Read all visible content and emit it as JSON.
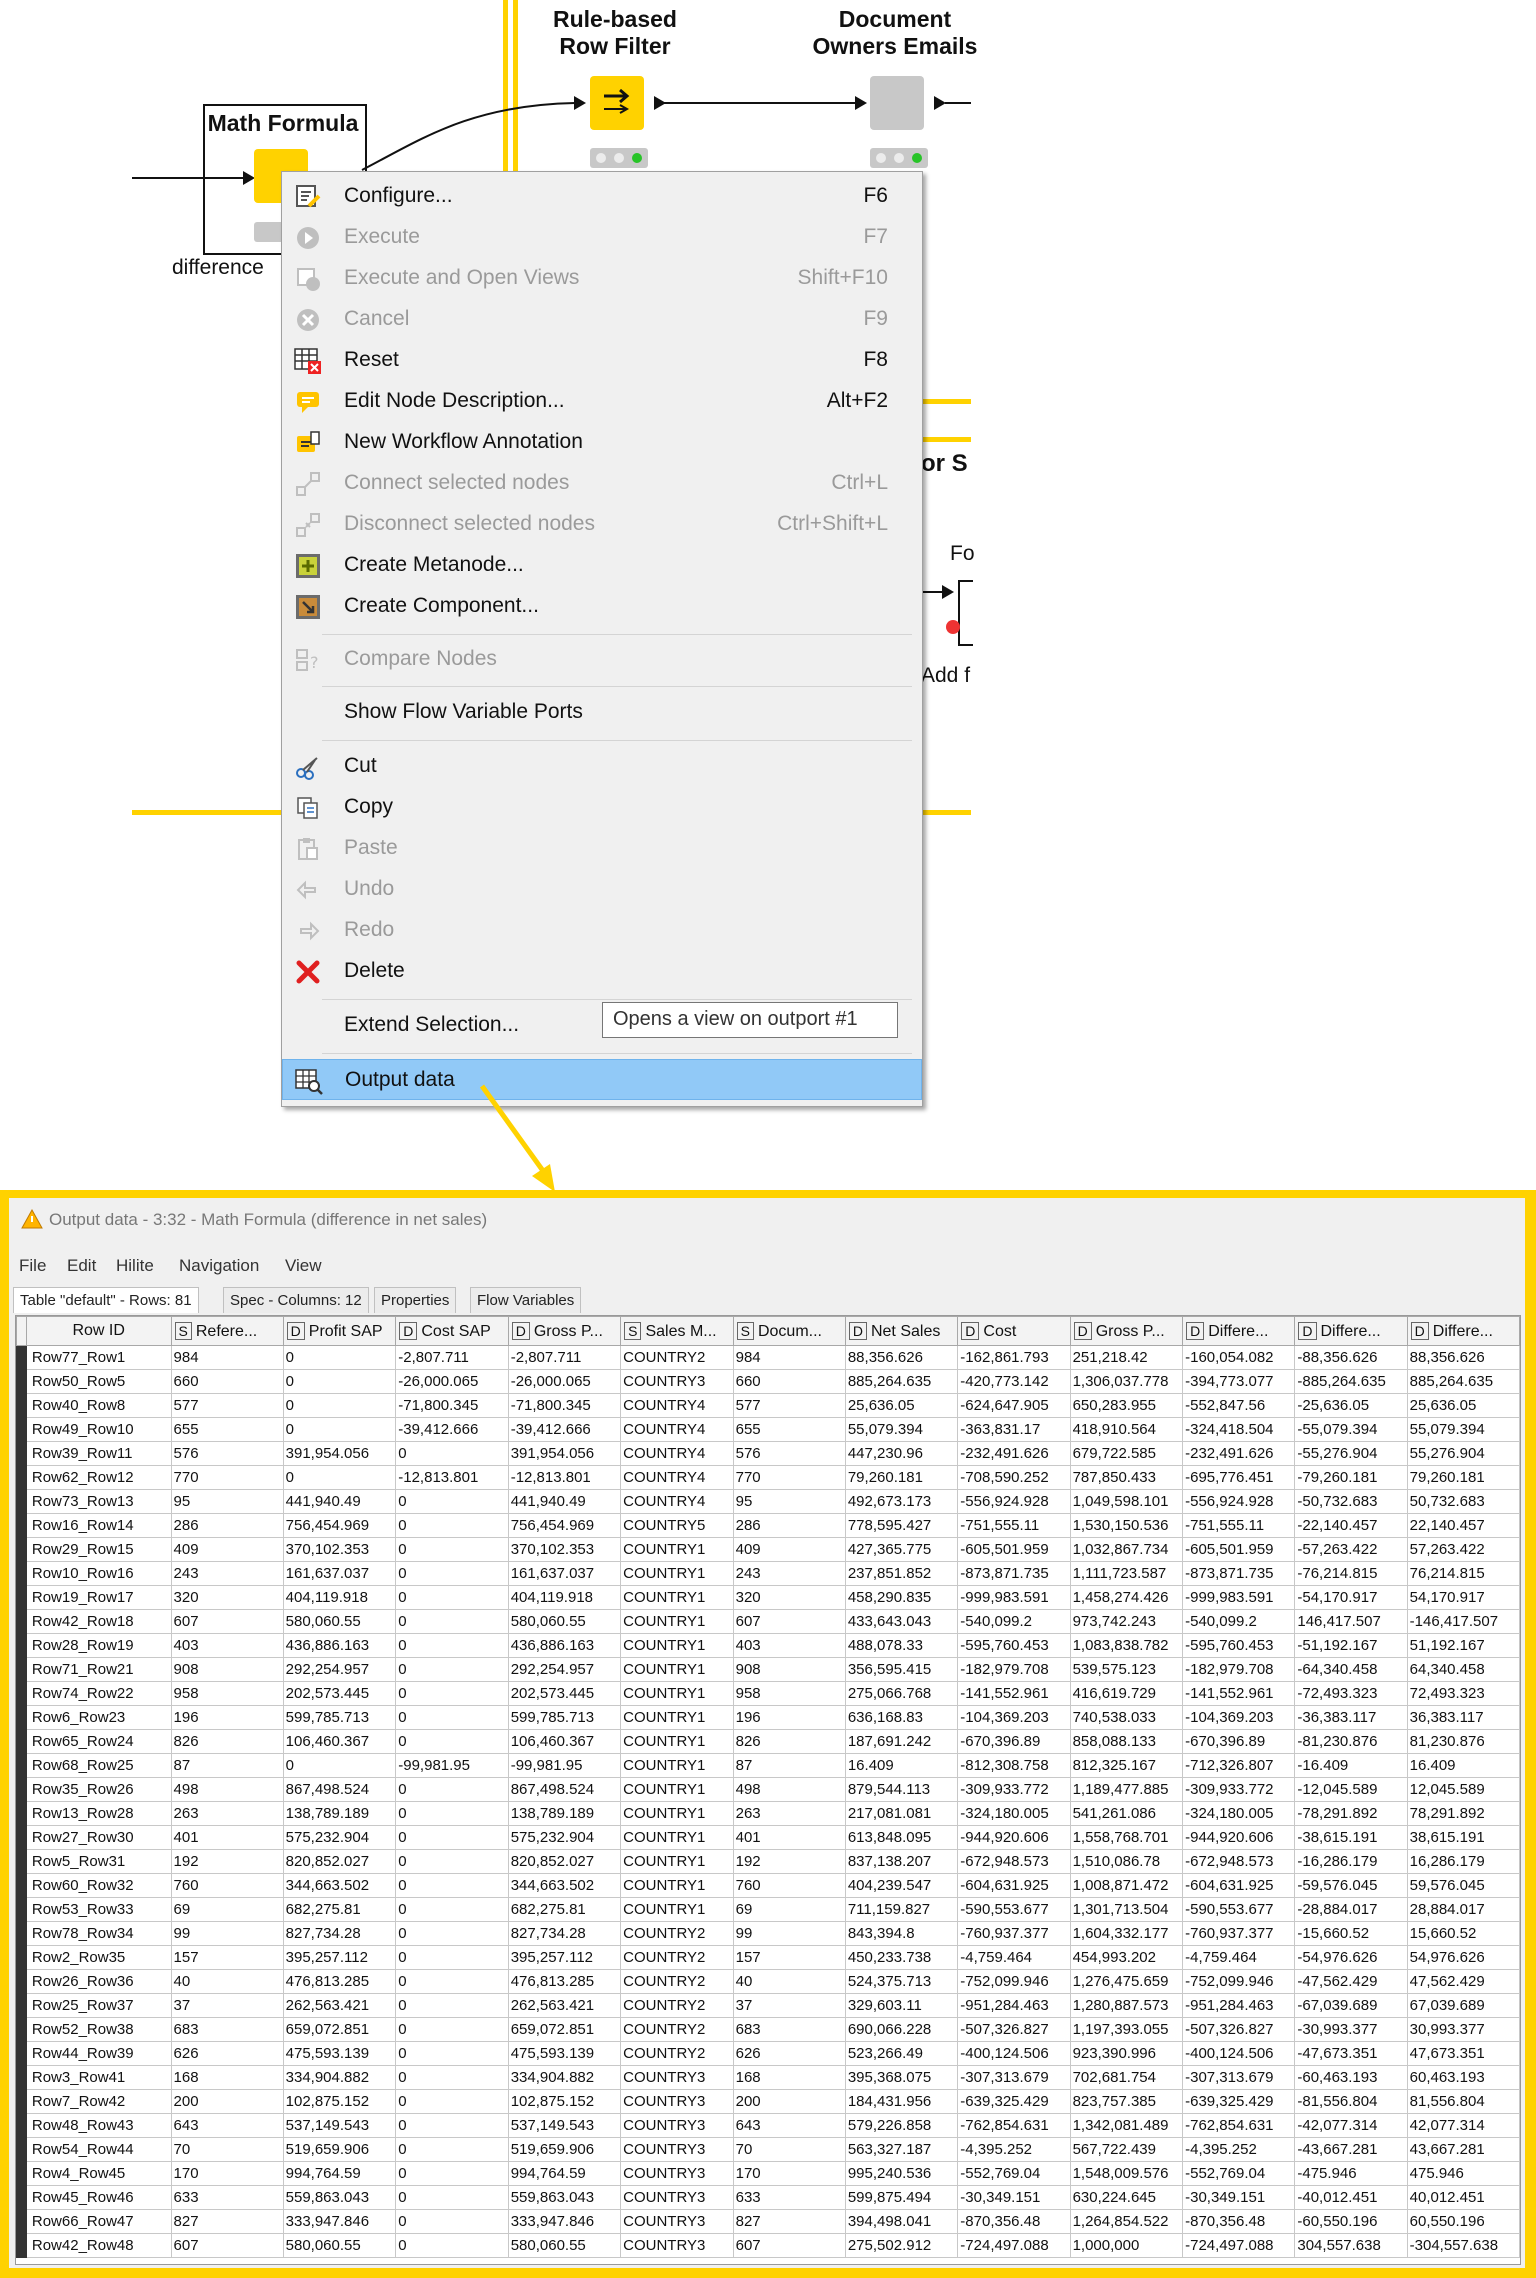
{
  "workflow": {
    "nodes": {
      "math_formula": {
        "title": "Math Formula",
        "label": "difference"
      },
      "rule_filter": {
        "title_line1": "Rule-based",
        "title_line2": "Row Filter"
      },
      "doc_owners": {
        "title_line1": "Document",
        "title_line2": "Owners Emails"
      }
    },
    "partial_texts": {
      "or_s": "or S",
      "fo": "Fo",
      "add_f": "Add f"
    },
    "colors": {
      "annotation_border": "#ffd200",
      "node_yellow": "#ffd200",
      "node_gray": "#c8c8c8"
    }
  },
  "context_menu": {
    "items": [
      {
        "label": "Configure...",
        "shortcut": "F6",
        "icon": "configure-icon",
        "enabled": true
      },
      {
        "label": "Execute",
        "shortcut": "F7",
        "icon": "execute-icon",
        "enabled": false
      },
      {
        "label": "Execute and Open Views",
        "shortcut": "Shift+F10",
        "icon": "execute-open-views-icon",
        "enabled": false
      },
      {
        "label": "Cancel",
        "shortcut": "F9",
        "icon": "cancel-icon",
        "enabled": false
      },
      {
        "label": "Reset",
        "shortcut": "F8",
        "icon": "reset-icon",
        "enabled": true
      },
      {
        "label": "Edit Node Description...",
        "shortcut": "Alt+F2",
        "icon": "edit-description-icon",
        "enabled": true
      },
      {
        "label": "New Workflow Annotation",
        "shortcut": "",
        "icon": "annotation-icon",
        "enabled": true
      },
      {
        "label": "Connect selected nodes",
        "shortcut": "Ctrl+L",
        "icon": "connect-icon",
        "enabled": false
      },
      {
        "label": "Disconnect selected nodes",
        "shortcut": "Ctrl+Shift+L",
        "icon": "disconnect-icon",
        "enabled": false
      },
      {
        "label": "Create Metanode...",
        "shortcut": "",
        "icon": "metanode-icon",
        "enabled": true
      },
      {
        "label": "Create Component...",
        "shortcut": "",
        "icon": "component-icon",
        "enabled": true
      },
      {
        "label": "Compare Nodes",
        "shortcut": "",
        "icon": "compare-icon",
        "enabled": false
      },
      {
        "label": "Show Flow Variable Ports",
        "shortcut": "",
        "icon": "",
        "enabled": true
      },
      {
        "label": "Cut",
        "shortcut": "",
        "icon": "cut-icon",
        "enabled": true
      },
      {
        "label": "Copy",
        "shortcut": "",
        "icon": "copy-icon",
        "enabled": true
      },
      {
        "label": "Paste",
        "shortcut": "",
        "icon": "paste-icon",
        "enabled": false
      },
      {
        "label": "Undo",
        "shortcut": "",
        "icon": "undo-icon",
        "enabled": false
      },
      {
        "label": "Redo",
        "shortcut": "",
        "icon": "redo-icon",
        "enabled": false
      },
      {
        "label": "Delete",
        "shortcut": "",
        "icon": "delete-icon",
        "enabled": true
      },
      {
        "label": "Extend Selection...",
        "shortcut": "",
        "icon": "",
        "enabled": true
      },
      {
        "label": "Output data",
        "shortcut": "",
        "icon": "output-data-icon",
        "enabled": true,
        "selected": true
      }
    ],
    "tooltip": "Opens a view on outport #1"
  },
  "output_window": {
    "title": "Output data - 3:32 - Math Formula (difference in net sales)",
    "menu": [
      "File",
      "Edit",
      "Hilite",
      "Navigation",
      "View"
    ],
    "tabs": [
      "Table \"default\" - Rows: 81",
      "Spec - Columns: 12",
      "Properties",
      "Flow Variables"
    ],
    "columns": [
      {
        "type": "",
        "name": "Row ID"
      },
      {
        "type": "S",
        "name": "Refere..."
      },
      {
        "type": "D",
        "name": "Profit SAP"
      },
      {
        "type": "D",
        "name": "Cost SAP"
      },
      {
        "type": "D",
        "name": "Gross P..."
      },
      {
        "type": "S",
        "name": "Sales M..."
      },
      {
        "type": "S",
        "name": "Docum..."
      },
      {
        "type": "D",
        "name": "Net Sales"
      },
      {
        "type": "D",
        "name": "Cost"
      },
      {
        "type": "D",
        "name": "Gross P..."
      },
      {
        "type": "D",
        "name": "Differe..."
      },
      {
        "type": "D",
        "name": "Differe..."
      },
      {
        "type": "D",
        "name": "Differe..."
      }
    ],
    "rows": [
      [
        "Row77_Row1",
        "984",
        "0",
        "-2,807.711",
        "-2,807.711",
        "COUNTRY2",
        "984",
        "88,356.626",
        "-162,861.793",
        "251,218.42",
        "-160,054.082",
        "-88,356.626",
        "88,356.626"
      ],
      [
        "Row50_Row5",
        "660",
        "0",
        "-26,000.065",
        "-26,000.065",
        "COUNTRY3",
        "660",
        "885,264.635",
        "-420,773.142",
        "1,306,037.778",
        "-394,773.077",
        "-885,264.635",
        "885,264.635"
      ],
      [
        "Row40_Row8",
        "577",
        "0",
        "-71,800.345",
        "-71,800.345",
        "COUNTRY4",
        "577",
        "25,636.05",
        "-624,647.905",
        "650,283.955",
        "-552,847.56",
        "-25,636.05",
        "25,636.05"
      ],
      [
        "Row49_Row10",
        "655",
        "0",
        "-39,412.666",
        "-39,412.666",
        "COUNTRY4",
        "655",
        "55,079.394",
        "-363,831.17",
        "418,910.564",
        "-324,418.504",
        "-55,079.394",
        "55,079.394"
      ],
      [
        "Row39_Row11",
        "576",
        "391,954.056",
        "0",
        "391,954.056",
        "COUNTRY4",
        "576",
        "447,230.96",
        "-232,491.626",
        "679,722.585",
        "-232,491.626",
        "-55,276.904",
        "55,276.904"
      ],
      [
        "Row62_Row12",
        "770",
        "0",
        "-12,813.801",
        "-12,813.801",
        "COUNTRY4",
        "770",
        "79,260.181",
        "-708,590.252",
        "787,850.433",
        "-695,776.451",
        "-79,260.181",
        "79,260.181"
      ],
      [
        "Row73_Row13",
        "95",
        "441,940.49",
        "0",
        "441,940.49",
        "COUNTRY4",
        "95",
        "492,673.173",
        "-556,924.928",
        "1,049,598.101",
        "-556,924.928",
        "-50,732.683",
        "50,732.683"
      ],
      [
        "Row16_Row14",
        "286",
        "756,454.969",
        "0",
        "756,454.969",
        "COUNTRY5",
        "286",
        "778,595.427",
        "-751,555.11",
        "1,530,150.536",
        "-751,555.11",
        "-22,140.457",
        "22,140.457"
      ],
      [
        "Row29_Row15",
        "409",
        "370,102.353",
        "0",
        "370,102.353",
        "COUNTRY1",
        "409",
        "427,365.775",
        "-605,501.959",
        "1,032,867.734",
        "-605,501.959",
        "-57,263.422",
        "57,263.422"
      ],
      [
        "Row10_Row16",
        "243",
        "161,637.037",
        "0",
        "161,637.037",
        "COUNTRY1",
        "243",
        "237,851.852",
        "-873,871.735",
        "1,111,723.587",
        "-873,871.735",
        "-76,214.815",
        "76,214.815"
      ],
      [
        "Row19_Row17",
        "320",
        "404,119.918",
        "0",
        "404,119.918",
        "COUNTRY1",
        "320",
        "458,290.835",
        "-999,983.591",
        "1,458,274.426",
        "-999,983.591",
        "-54,170.917",
        "54,170.917"
      ],
      [
        "Row42_Row18",
        "607",
        "580,060.55",
        "0",
        "580,060.55",
        "COUNTRY1",
        "607",
        "433,643.043",
        "-540,099.2",
        "973,742.243",
        "-540,099.2",
        "146,417.507",
        "-146,417.507"
      ],
      [
        "Row28_Row19",
        "403",
        "436,886.163",
        "0",
        "436,886.163",
        "COUNTRY1",
        "403",
        "488,078.33",
        "-595,760.453",
        "1,083,838.782",
        "-595,760.453",
        "-51,192.167",
        "51,192.167"
      ],
      [
        "Row71_Row21",
        "908",
        "292,254.957",
        "0",
        "292,254.957",
        "COUNTRY1",
        "908",
        "356,595.415",
        "-182,979.708",
        "539,575.123",
        "-182,979.708",
        "-64,340.458",
        "64,340.458"
      ],
      [
        "Row74_Row22",
        "958",
        "202,573.445",
        "0",
        "202,573.445",
        "COUNTRY1",
        "958",
        "275,066.768",
        "-141,552.961",
        "416,619.729",
        "-141,552.961",
        "-72,493.323",
        "72,493.323"
      ],
      [
        "Row6_Row23",
        "196",
        "599,785.713",
        "0",
        "599,785.713",
        "COUNTRY1",
        "196",
        "636,168.83",
        "-104,369.203",
        "740,538.033",
        "-104,369.203",
        "-36,383.117",
        "36,383.117"
      ],
      [
        "Row65_Row24",
        "826",
        "106,460.367",
        "0",
        "106,460.367",
        "COUNTRY1",
        "826",
        "187,691.242",
        "-670,396.89",
        "858,088.133",
        "-670,396.89",
        "-81,230.876",
        "81,230.876"
      ],
      [
        "Row68_Row25",
        "87",
        "0",
        "-99,981.95",
        "-99,981.95",
        "COUNTRY1",
        "87",
        "16.409",
        "-812,308.758",
        "812,325.167",
        "-712,326.807",
        "-16.409",
        "16.409"
      ],
      [
        "Row35_Row26",
        "498",
        "867,498.524",
        "0",
        "867,498.524",
        "COUNTRY1",
        "498",
        "879,544.113",
        "-309,933.772",
        "1,189,477.885",
        "-309,933.772",
        "-12,045.589",
        "12,045.589"
      ],
      [
        "Row13_Row28",
        "263",
        "138,789.189",
        "0",
        "138,789.189",
        "COUNTRY1",
        "263",
        "217,081.081",
        "-324,180.005",
        "541,261.086",
        "-324,180.005",
        "-78,291.892",
        "78,291.892"
      ],
      [
        "Row27_Row30",
        "401",
        "575,232.904",
        "0",
        "575,232.904",
        "COUNTRY1",
        "401",
        "613,848.095",
        "-944,920.606",
        "1,558,768.701",
        "-944,920.606",
        "-38,615.191",
        "38,615.191"
      ],
      [
        "Row5_Row31",
        "192",
        "820,852.027",
        "0",
        "820,852.027",
        "COUNTRY1",
        "192",
        "837,138.207",
        "-672,948.573",
        "1,510,086.78",
        "-672,948.573",
        "-16,286.179",
        "16,286.179"
      ],
      [
        "Row60_Row32",
        "760",
        "344,663.502",
        "0",
        "344,663.502",
        "COUNTRY1",
        "760",
        "404,239.547",
        "-604,631.925",
        "1,008,871.472",
        "-604,631.925",
        "-59,576.045",
        "59,576.045"
      ],
      [
        "Row53_Row33",
        "69",
        "682,275.81",
        "0",
        "682,275.81",
        "COUNTRY1",
        "69",
        "711,159.827",
        "-590,553.677",
        "1,301,713.504",
        "-590,553.677",
        "-28,884.017",
        "28,884.017"
      ],
      [
        "Row78_Row34",
        "99",
        "827,734.28",
        "0",
        "827,734.28",
        "COUNTRY2",
        "99",
        "843,394.8",
        "-760,937.377",
        "1,604,332.177",
        "-760,937.377",
        "-15,660.52",
        "15,660.52"
      ],
      [
        "Row2_Row35",
        "157",
        "395,257.112",
        "0",
        "395,257.112",
        "COUNTRY2",
        "157",
        "450,233.738",
        "-4,759.464",
        "454,993.202",
        "-4,759.464",
        "-54,976.626",
        "54,976.626"
      ],
      [
        "Row26_Row36",
        "40",
        "476,813.285",
        "0",
        "476,813.285",
        "COUNTRY2",
        "40",
        "524,375.713",
        "-752,099.946",
        "1,276,475.659",
        "-752,099.946",
        "-47,562.429",
        "47,562.429"
      ],
      [
        "Row25_Row37",
        "37",
        "262,563.421",
        "0",
        "262,563.421",
        "COUNTRY2",
        "37",
        "329,603.11",
        "-951,284.463",
        "1,280,887.573",
        "-951,284.463",
        "-67,039.689",
        "67,039.689"
      ],
      [
        "Row52_Row38",
        "683",
        "659,072.851",
        "0",
        "659,072.851",
        "COUNTRY2",
        "683",
        "690,066.228",
        "-507,326.827",
        "1,197,393.055",
        "-507,326.827",
        "-30,993.377",
        "30,993.377"
      ],
      [
        "Row44_Row39",
        "626",
        "475,593.139",
        "0",
        "475,593.139",
        "COUNTRY2",
        "626",
        "523,266.49",
        "-400,124.506",
        "923,390.996",
        "-400,124.506",
        "-47,673.351",
        "47,673.351"
      ],
      [
        "Row3_Row41",
        "168",
        "334,904.882",
        "0",
        "334,904.882",
        "COUNTRY3",
        "168",
        "395,368.075",
        "-307,313.679",
        "702,681.754",
        "-307,313.679",
        "-60,463.193",
        "60,463.193"
      ],
      [
        "Row7_Row42",
        "200",
        "102,875.152",
        "0",
        "102,875.152",
        "COUNTRY3",
        "200",
        "184,431.956",
        "-639,325.429",
        "823,757.385",
        "-639,325.429",
        "-81,556.804",
        "81,556.804"
      ],
      [
        "Row48_Row43",
        "643",
        "537,149.543",
        "0",
        "537,149.543",
        "COUNTRY3",
        "643",
        "579,226.858",
        "-762,854.631",
        "1,342,081.489",
        "-762,854.631",
        "-42,077.314",
        "42,077.314"
      ],
      [
        "Row54_Row44",
        "70",
        "519,659.906",
        "0",
        "519,659.906",
        "COUNTRY3",
        "70",
        "563,327.187",
        "-4,395.252",
        "567,722.439",
        "-4,395.252",
        "-43,667.281",
        "43,667.281"
      ],
      [
        "Row4_Row45",
        "170",
        "994,764.59",
        "0",
        "994,764.59",
        "COUNTRY3",
        "170",
        "995,240.536",
        "-552,769.04",
        "1,548,009.576",
        "-552,769.04",
        "-475.946",
        "475.946"
      ],
      [
        "Row45_Row46",
        "633",
        "559,863.043",
        "0",
        "559,863.043",
        "COUNTRY3",
        "633",
        "599,875.494",
        "-30,349.151",
        "630,224.645",
        "-30,349.151",
        "-40,012.451",
        "40,012.451"
      ],
      [
        "Row66_Row47",
        "827",
        "333,947.846",
        "0",
        "333,947.846",
        "COUNTRY3",
        "827",
        "394,498.041",
        "-870,356.48",
        "1,264,854.522",
        "-870,356.48",
        "-60,550.196",
        "60,550.196"
      ],
      [
        "Row42_Row48",
        "607",
        "580,060.55",
        "0",
        "580,060.55",
        "COUNTRY3",
        "607",
        "275,502.912",
        "-724,497.088",
        "1,000,000",
        "-724,497.088",
        "304,557.638",
        "-304,557.638"
      ]
    ]
  }
}
